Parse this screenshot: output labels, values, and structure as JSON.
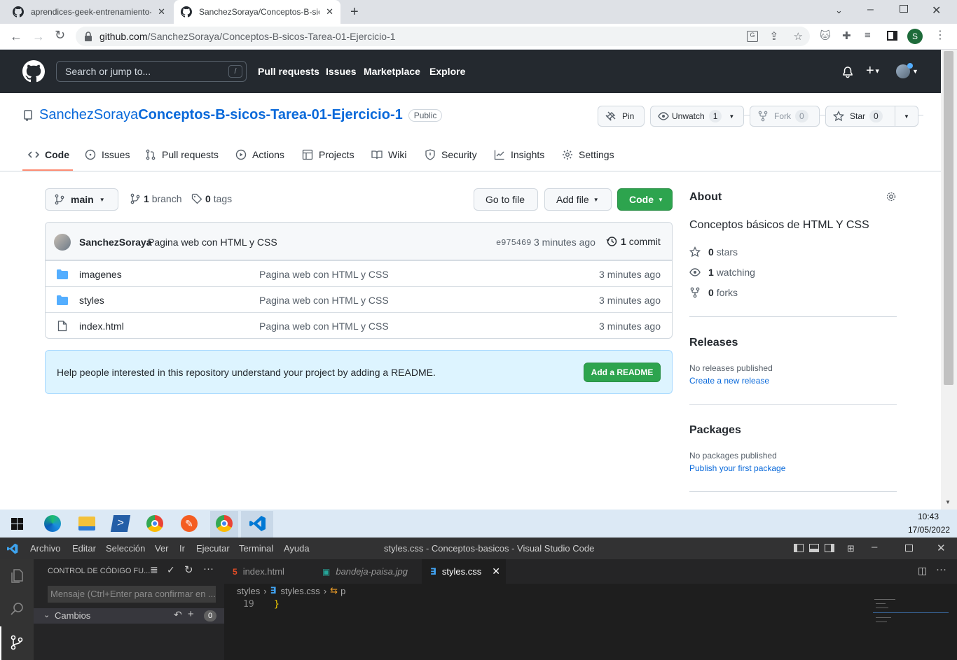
{
  "browser": {
    "tabs": [
      {
        "title": "aprendices-geek-entrenamiento-"
      },
      {
        "title": "SanchezSoraya/Conceptos-B-sicos"
      }
    ],
    "url_host": "github.com",
    "url_path": "/SanchezSoraya/Conceptos-B-sicos-Tarea-01-Ejercicio-1",
    "profile_initial": "S"
  },
  "github": {
    "search_placeholder": "Search or jump to...",
    "search_shortcut": "/",
    "nav": [
      "Pull requests",
      "Issues",
      "Marketplace",
      "Explore"
    ],
    "owner": "SanchezSoraya",
    "separator": "/",
    "repo": "Conceptos-B-sicos-Tarea-01-Ejercicio-1",
    "visibility": "Public",
    "actions": {
      "pin": "Pin",
      "unwatch": "Unwatch",
      "unwatch_count": "1",
      "fork": "Fork",
      "fork_count": "0",
      "star": "Star",
      "star_count": "0"
    },
    "repo_tabs": [
      "Code",
      "Issues",
      "Pull requests",
      "Actions",
      "Projects",
      "Wiki",
      "Security",
      "Insights",
      "Settings"
    ],
    "branch": "main",
    "branch_count": "1",
    "branch_label": "branch",
    "tag_count": "0",
    "tag_label": "tags",
    "go_to_file": "Go to file",
    "add_file": "Add file",
    "code_button": "Code",
    "commit": {
      "author": "SanchezSoraya",
      "message": "Pagina web con HTML y CSS",
      "hash": "e975469",
      "time": "3 minutes ago",
      "count": "1",
      "count_label": "commit"
    },
    "files": [
      {
        "name": "imagenes",
        "type": "folder",
        "message": "Pagina web con HTML y CSS",
        "time": "3 minutes ago"
      },
      {
        "name": "styles",
        "type": "folder",
        "message": "Pagina web con HTML y CSS",
        "time": "3 minutes ago"
      },
      {
        "name": "index.html",
        "type": "file",
        "message": "Pagina web con HTML y CSS",
        "time": "3 minutes ago"
      }
    ],
    "readme_prompt": "Help people interested in this repository understand your project by adding a README.",
    "add_readme": "Add a README",
    "about": {
      "heading": "About",
      "description": "Conceptos básicos de HTML Y CSS",
      "stars": "0",
      "stars_label": "stars",
      "watching": "1",
      "watching_label": "watching",
      "forks": "0",
      "forks_label": "forks"
    },
    "releases": {
      "heading": "Releases",
      "none": "No releases published",
      "link": "Create a new release"
    },
    "packages": {
      "heading": "Packages",
      "none": "No packages published",
      "link": "Publish your first package"
    }
  },
  "taskbar": {
    "time": "10:43",
    "date": "17/05/2022"
  },
  "vscode": {
    "menu": [
      "Archivo",
      "Editar",
      "Selección",
      "Ver",
      "Ir",
      "Ejecutar",
      "Terminal",
      "Ayuda"
    ],
    "window_title": "styles.css - Conceptos-basicos - Visual Studio Code",
    "scm_title": "CONTROL DE CÓDIGO FU...",
    "commit_placeholder": "Mensaje (Ctrl+Enter para confirmar en ...",
    "changes_label": "Cambios",
    "changes_count": "0",
    "tabs": [
      "index.html",
      "bandeja-paisa.jpg",
      "styles.css"
    ],
    "breadcrumb": [
      "styles",
      "styles.css",
      "p"
    ],
    "line_number": "19",
    "line_text": "}"
  },
  "colors": {
    "github_header": "#24292f",
    "link": "#0969da",
    "green": "#2da44e",
    "readme_bg": "#ddf4ff",
    "folder": "#54aeff",
    "vscode_bg": "#1e1e1e"
  }
}
